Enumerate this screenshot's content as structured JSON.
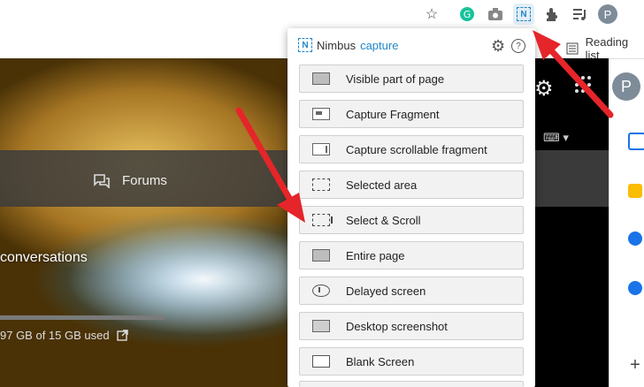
{
  "toolbar": {
    "profile_initial": "P"
  },
  "bookmarks": {
    "reading_list": "Reading list"
  },
  "background": {
    "forums": "Forums",
    "conversations": "conversations",
    "storage": "97 GB of 15 GB used",
    "profile_initial": "P"
  },
  "popup": {
    "brand": "Nimbus",
    "brand_accent": "capture",
    "logo_letter": "N",
    "help": "?",
    "items": [
      {
        "label": "Visible part of page"
      },
      {
        "label": "Capture Fragment"
      },
      {
        "label": "Capture scrollable fragment"
      },
      {
        "label": "Selected area"
      },
      {
        "label": "Select & Scroll"
      },
      {
        "label": "Entire page"
      },
      {
        "label": "Delayed screen"
      },
      {
        "label": "Desktop screenshot"
      },
      {
        "label": "Blank Screen"
      }
    ]
  },
  "colors": {
    "accent": "#1e88c7",
    "arrow": "#e5252a"
  },
  "icons": [
    "star-icon",
    "grammarly-icon",
    "camera-icon",
    "nimbus-icon",
    "extensions-icon",
    "media-icon",
    "gear-icon",
    "help-icon",
    "apps-icon"
  ]
}
